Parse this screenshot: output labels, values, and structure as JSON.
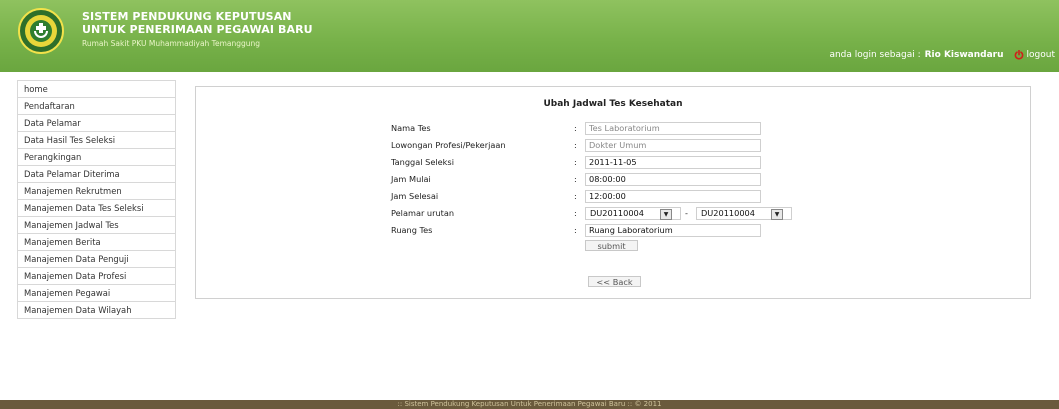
{
  "header": {
    "title_line1": "SISTEM PENDUKUNG KEPUTUSAN",
    "title_line2": "UNTUK PENERIMAAN PEGAWAI BARU",
    "subtitle": "Rumah Sakit PKU Muhammadiyah Temanggung",
    "login_prefix": "anda login sebagai :",
    "username": "Rio Kiswandaru",
    "logout_label": "logout",
    "logo_icon": "hospital-logo-icon",
    "logout_icon": "power-icon"
  },
  "sidebar": {
    "items": [
      {
        "label": "home"
      },
      {
        "label": "Pendaftaran"
      },
      {
        "label": "Data Pelamar"
      },
      {
        "label": "Data Hasil Tes Seleksi"
      },
      {
        "label": "Perangkingan"
      },
      {
        "label": "Data Pelamar Diterima"
      },
      {
        "label": "Manajemen Rekrutmen"
      },
      {
        "label": "Manajemen Data Tes Seleksi"
      },
      {
        "label": "Manajemen Jadwal Tes"
      },
      {
        "label": "Manajemen Berita"
      },
      {
        "label": "Manajemen Data Penguji"
      },
      {
        "label": "Manajemen Data Profesi"
      },
      {
        "label": "Manajemen Pegawai"
      },
      {
        "label": "Manajemen Data Wilayah"
      }
    ]
  },
  "form": {
    "title": "Ubah Jadwal Tes Kesehatan",
    "colon": ":",
    "fields": {
      "nama_tes": {
        "label": "Nama Tes",
        "value": "Tes Laboratorium"
      },
      "lowongan": {
        "label": "Lowongan Profesi/Pekerjaan",
        "value": "Dokter Umum"
      },
      "tanggal": {
        "label": "Tanggal Seleksi",
        "value": "2011-11-05"
      },
      "jam_mulai": {
        "label": "Jam Mulai",
        "value": "08:00:00"
      },
      "jam_selesai": {
        "label": "Jam Selesai",
        "value": "12:00:00"
      },
      "pelamar": {
        "label": "Pelamar urutan",
        "from": "DU20110004",
        "separator": "-",
        "to": "DU20110004"
      },
      "ruang": {
        "label": "Ruang Tes",
        "value": "Ruang Laboratorium"
      }
    },
    "submit_label": "submit",
    "back_label": "<< Back"
  },
  "footer": {
    "text": ":: Sistem Pendukung Keputusan Untuk Penerimaan Pegawai Baru ::  © 2011"
  },
  "colors": {
    "header_green": "#78b24a",
    "footer_brown": "#6a5a3c"
  }
}
